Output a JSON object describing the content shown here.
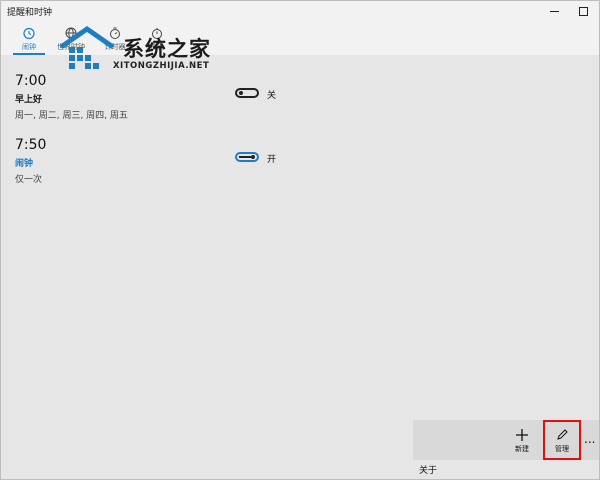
{
  "window": {
    "title": "提醒和时钟"
  },
  "tabs": [
    {
      "label": "闹钟",
      "icon": "alarm-clock-icon",
      "active": true
    },
    {
      "label": "世界时钟",
      "icon": "globe-icon",
      "active": false
    },
    {
      "label": "计时器",
      "icon": "timer-icon",
      "active": false
    },
    {
      "label": "秒表",
      "icon": "stopwatch-icon",
      "active": false
    }
  ],
  "watermark": {
    "title": "系统之家",
    "subtitle": "XITONGZHIJIA.NET"
  },
  "alarms": [
    {
      "time": "7:00",
      "name": "早上好",
      "repeat": "周一, 周二, 周三, 周四, 周五",
      "state_label": "关",
      "enabled": false
    },
    {
      "time": "7:50",
      "name": "闹钟",
      "repeat": "仅一次",
      "state_label": "开",
      "enabled": true
    }
  ],
  "commands": {
    "new_label": "新建",
    "manage_label": "管理",
    "more": "..."
  },
  "footer": {
    "about_label": "关于"
  },
  "colors": {
    "accent": "#1f7ec2",
    "highlight": "#e01010",
    "background": "#e6e6e6"
  }
}
